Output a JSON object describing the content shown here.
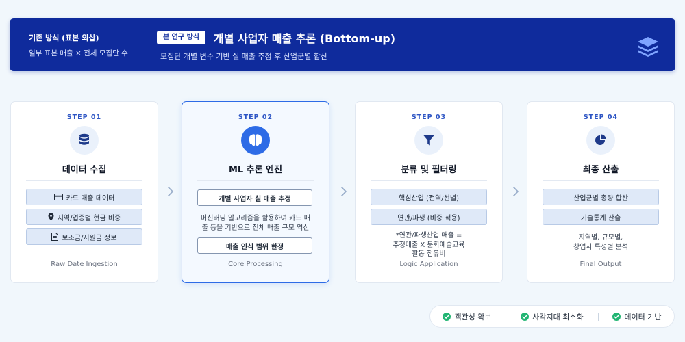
{
  "banner": {
    "legacy_title": "기존 방식 (표본 외삽)",
    "legacy_desc": "일부 표본 매출 × 전체 모집단 수",
    "badge": "본 연구 방식",
    "title": "개별 사업자 매출 추론 (Bottom-up)",
    "desc": "모집단 개별 변수 기반 실 매출 추정 후 산업군별 합산",
    "icon": "layers-icon"
  },
  "steps": [
    {
      "label": "STEP 01",
      "title": "데이터 수집",
      "icon": "database-icon",
      "items": [
        {
          "text": "카드 매출 데이터",
          "icon": "credit-card-icon"
        },
        {
          "text": "지역/업종별 현금 비중",
          "icon": "map-pin-icon"
        },
        {
          "text": "보조금/지원금 정보",
          "icon": "document-icon"
        }
      ],
      "footer": "Raw Date Ingestion"
    },
    {
      "label": "STEP 02",
      "title": "ML 추론 엔진",
      "icon": "brain-icon",
      "box1": "개별 사업자 실 매출 추정",
      "note": "머신러닝 알고리즘을 활용하여 카드 매출 등을 기반으로 전체 매출 규모 역산",
      "box2": "매출 인식 범위 한정",
      "footer": "Core Processing"
    },
    {
      "label": "STEP 03",
      "title": "분류 및 필터링",
      "icon": "filter-icon",
      "items": [
        {
          "text": "핵심산업 (전역/선별)"
        },
        {
          "text": "연관/파생 (비중 적용)"
        }
      ],
      "note_lines": [
        "*연관/파생산업 매출 =",
        "추정매출 X 문화예술교육",
        "활동 점유비"
      ],
      "footer": "Logic Application"
    },
    {
      "label": "STEP 04",
      "title": "최종 산출",
      "icon": "pie-chart-icon",
      "items": [
        {
          "text": "산업군별 총량 합산"
        },
        {
          "text": "기술통계 산출"
        }
      ],
      "note_lines": [
        "지역별, 규모별,",
        "창업자 특성별 분석"
      ],
      "footer": "Final Output"
    }
  ],
  "checks": [
    {
      "text": "객관성 확보",
      "icon": "check-circle-icon"
    },
    {
      "text": "사각지대 최소화",
      "icon": "check-circle-icon"
    },
    {
      "text": "데이터 기반",
      "icon": "check-circle-icon"
    }
  ],
  "colors": {
    "banner_bg": "#0f2b9c",
    "accent": "#2d6be6",
    "check_green": "#22b573"
  }
}
